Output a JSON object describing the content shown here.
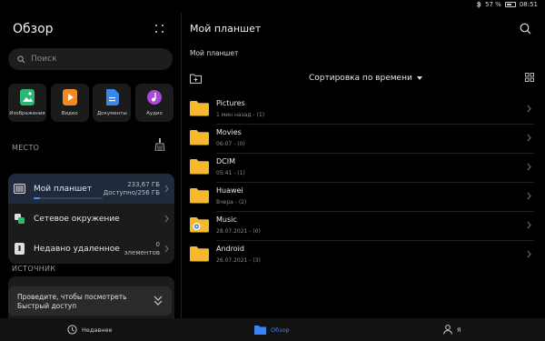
{
  "status": {
    "battery": "57 %",
    "time": "08:51"
  },
  "sidebar": {
    "title": "Обзор",
    "search_placeholder": "Поиск",
    "categories": [
      {
        "label": "Изображения",
        "icon": "image-icon",
        "color": "#2fb574"
      },
      {
        "label": "Видео",
        "icon": "video-icon",
        "color": "#f08a24"
      },
      {
        "label": "Документы",
        "icon": "document-icon",
        "color": "#3a86e8"
      },
      {
        "label": "Аудио",
        "icon": "audio-icon",
        "color": "#a74ad9"
      }
    ],
    "location_label": "МЕСТО",
    "locations": [
      {
        "label": "Мой планшет",
        "meta1": "233,67 ГБ",
        "meta2": "Доступно/256 ГБ",
        "usage_fraction": 0.09
      },
      {
        "label": "Сетевое окружение",
        "meta1": "",
        "meta2": ""
      },
      {
        "label": "Недавно удаленное",
        "meta1": "0",
        "meta2": "элементов"
      }
    ],
    "source_label": "ИСТОЧНИК",
    "swipe_tip": {
      "line1": "Проведите, чтобы посмотреть",
      "line2": "Быстрый доступ"
    }
  },
  "main": {
    "title": "Мой планшет",
    "breadcrumb": "Мой планшет",
    "sort_label": "Сортировка по времени",
    "files": [
      {
        "name": "Pictures",
        "meta": "1 мин назад - (1)"
      },
      {
        "name": "Movies",
        "meta": "06:07 - (0)"
      },
      {
        "name": "DCIM",
        "meta": "05:41 - (1)"
      },
      {
        "name": "Huawei",
        "meta": "Вчера - (2)"
      },
      {
        "name": "Music",
        "meta": "28.07.2021 - (0)",
        "badge": true
      },
      {
        "name": "Android",
        "meta": "26.07.2021 - (3)"
      }
    ]
  },
  "bottom_nav": {
    "recent": "Недавнее",
    "browse": "Обзор",
    "me": "Я"
  },
  "colors": {
    "accent": "#3b82f6",
    "folder": "#f5b82e",
    "active_row": "#1f2b3c"
  }
}
